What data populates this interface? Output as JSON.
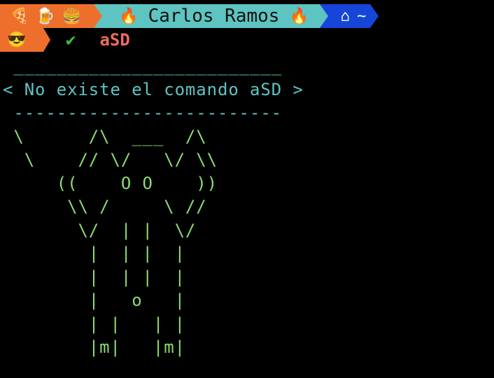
{
  "prompt": {
    "emojis": "🍕🍺🍔",
    "user_name": "Carlos Ramos",
    "fire": "🔥",
    "home_glyph": "⌂",
    "path": "~",
    "status_emoji": "😎",
    "status_check": "✔",
    "command": "aSD"
  },
  "output": {
    "bubble_top": " _________________________",
    "bubble_message": "< No existe el comando aSD >",
    "bubble_bottom": " -------------------------",
    "art": " \\      /\\  ___  /\\\n  \\    // \\/   \\/ \\\\\n     ((    O O    ))\n      \\\\ /     \\ //\n       \\/  | |  \\/\n        |  | |  |\n        |  | |  |\n        |   o   |\n        | |   | |\n        |m|   |m|"
  },
  "colors": {
    "orange": "#ee6f2c",
    "teal": "#5ec4c2",
    "blue": "#1646d8",
    "green": "#8cdc70",
    "error_red": "#ef6b5e",
    "check_green": "#3fbf3f"
  }
}
